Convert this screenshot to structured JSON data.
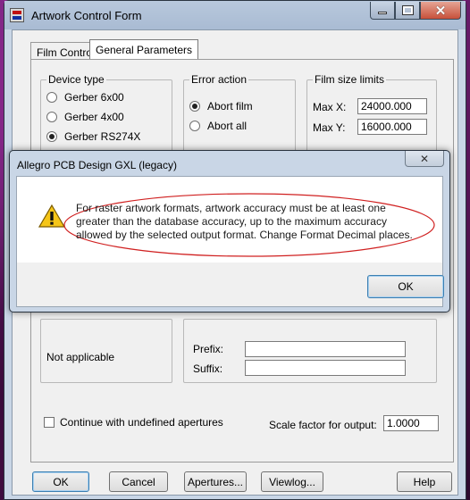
{
  "window": {
    "title": "Artwork Control Form"
  },
  "tabs": [
    "Film Control",
    "General Parameters"
  ],
  "device_type": {
    "title": "Device type",
    "options": [
      "Gerber 6x00",
      "Gerber 4x00",
      "Gerber RS274X"
    ],
    "selected": "Gerber RS274X"
  },
  "error_action": {
    "title": "Error action",
    "options": [
      "Abort film",
      "Abort all"
    ],
    "selected": "Abort film"
  },
  "film_size": {
    "title": "Film size limits",
    "max_x_label": "Max X:",
    "max_x_value": "24000.000",
    "max_y_label": "Max Y:",
    "max_y_value": "16000.000"
  },
  "lower": {
    "not_applicable": "Not applicable",
    "prefix_label": "Prefix:",
    "prefix_value": "",
    "suffix_label": "Suffix:",
    "suffix_value": "",
    "continue_label": "Continue with undefined apertures",
    "scale_label": "Scale factor for output:",
    "scale_value": "1.0000"
  },
  "buttons": {
    "ok": "OK",
    "cancel": "Cancel",
    "apertures": "Apertures...",
    "viewlog": "Viewlog...",
    "help": "Help"
  },
  "dialog": {
    "title": "Allegro PCB Design GXL (legacy)",
    "message_line1": "For raster artwork formats, artwork accuracy must be at least one",
    "message_line2": "greater than the database accuracy, up to the maximum accuracy",
    "message_line3": "allowed by the selected output format. Change Format Decimal places.",
    "ok": "OK",
    "close_glyph": "✕",
    "icon": "warning-icon",
    "highlight_color": "#d02020"
  },
  "icons": {
    "close": "close-icon",
    "minimize": "minimize-icon",
    "maximize": "maximize-icon",
    "app": "app-icon"
  }
}
